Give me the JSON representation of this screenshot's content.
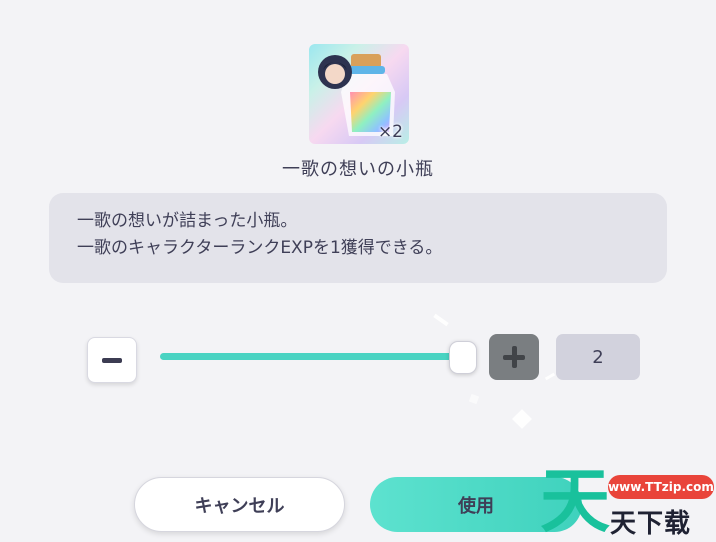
{
  "item": {
    "icon": "bottle-with-character-portrait-icon",
    "quantity_badge": "×2",
    "name": "一歌の想いの小瓶",
    "description": [
      "一歌の想いが詰まった小瓶。",
      "一歌のキャラクターランクEXPを1獲得できる。"
    ]
  },
  "quantity_selector": {
    "minus_icon": "minus-icon",
    "plus_icon": "plus-icon",
    "value": "2",
    "slider_fraction": 1.0,
    "accent_color": "#49d3c2"
  },
  "actions": {
    "cancel_label": "キャンセル",
    "use_label": "使用"
  },
  "watermark": {
    "big_char": "天",
    "url": "www.TTzip.com",
    "text": "天下载"
  }
}
